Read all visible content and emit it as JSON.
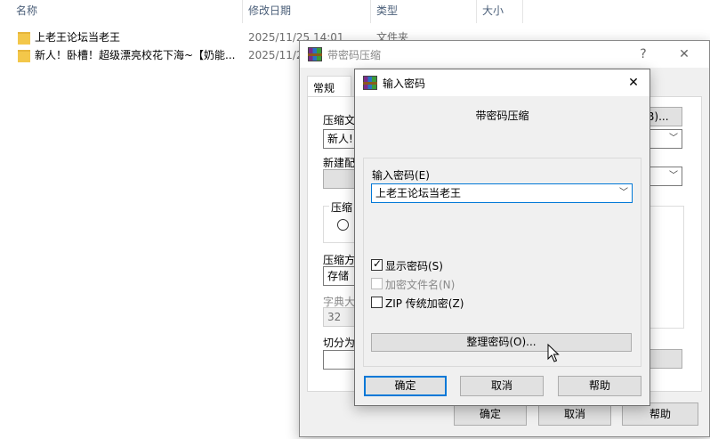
{
  "explorer": {
    "columns": [
      "名称",
      "修改日期",
      "类型",
      "大小"
    ],
    "rows": [
      {
        "name": "上老王论坛当老王",
        "date": "2025/11/25 14:01",
        "type": "文件夹"
      },
      {
        "name": "新人！卧槽！超级漂亮校花下海~【奶能...",
        "date": "2025/11/2"
      }
    ]
  },
  "archive_dialog": {
    "title": "带密码压缩",
    "help_glyph": "?",
    "close_glyph": "✕",
    "tab_general": "常规",
    "labels": {
      "archive_name": "压缩文",
      "update_mode": "新建配",
      "format_group": "压缩",
      "method": "压缩方",
      "dict_size": "字典大",
      "split": "切分为"
    },
    "browse_button": "(B)...",
    "archive_name_value": "新人!",
    "method_value": "存储",
    "dict_value": "32",
    "buttons": {
      "ok": "确定",
      "cancel": "取消",
      "help": "帮助"
    }
  },
  "password_dialog": {
    "title": "输入密码",
    "close_glyph": "✕",
    "heading": "带密码压缩",
    "password_label": "输入密码(E)",
    "password_value": "上老王论坛当老王",
    "show_password": {
      "label": "显示密码(S)",
      "checked": true
    },
    "encrypt_names": {
      "label": "加密文件名(N)",
      "checked": false,
      "disabled": true
    },
    "zip_legacy": {
      "label": "ZIP 传统加密(Z)",
      "checked": false
    },
    "organize_button": "整理密码(O)...",
    "buttons": {
      "ok": "确定",
      "cancel": "取消",
      "help": "帮助"
    }
  }
}
